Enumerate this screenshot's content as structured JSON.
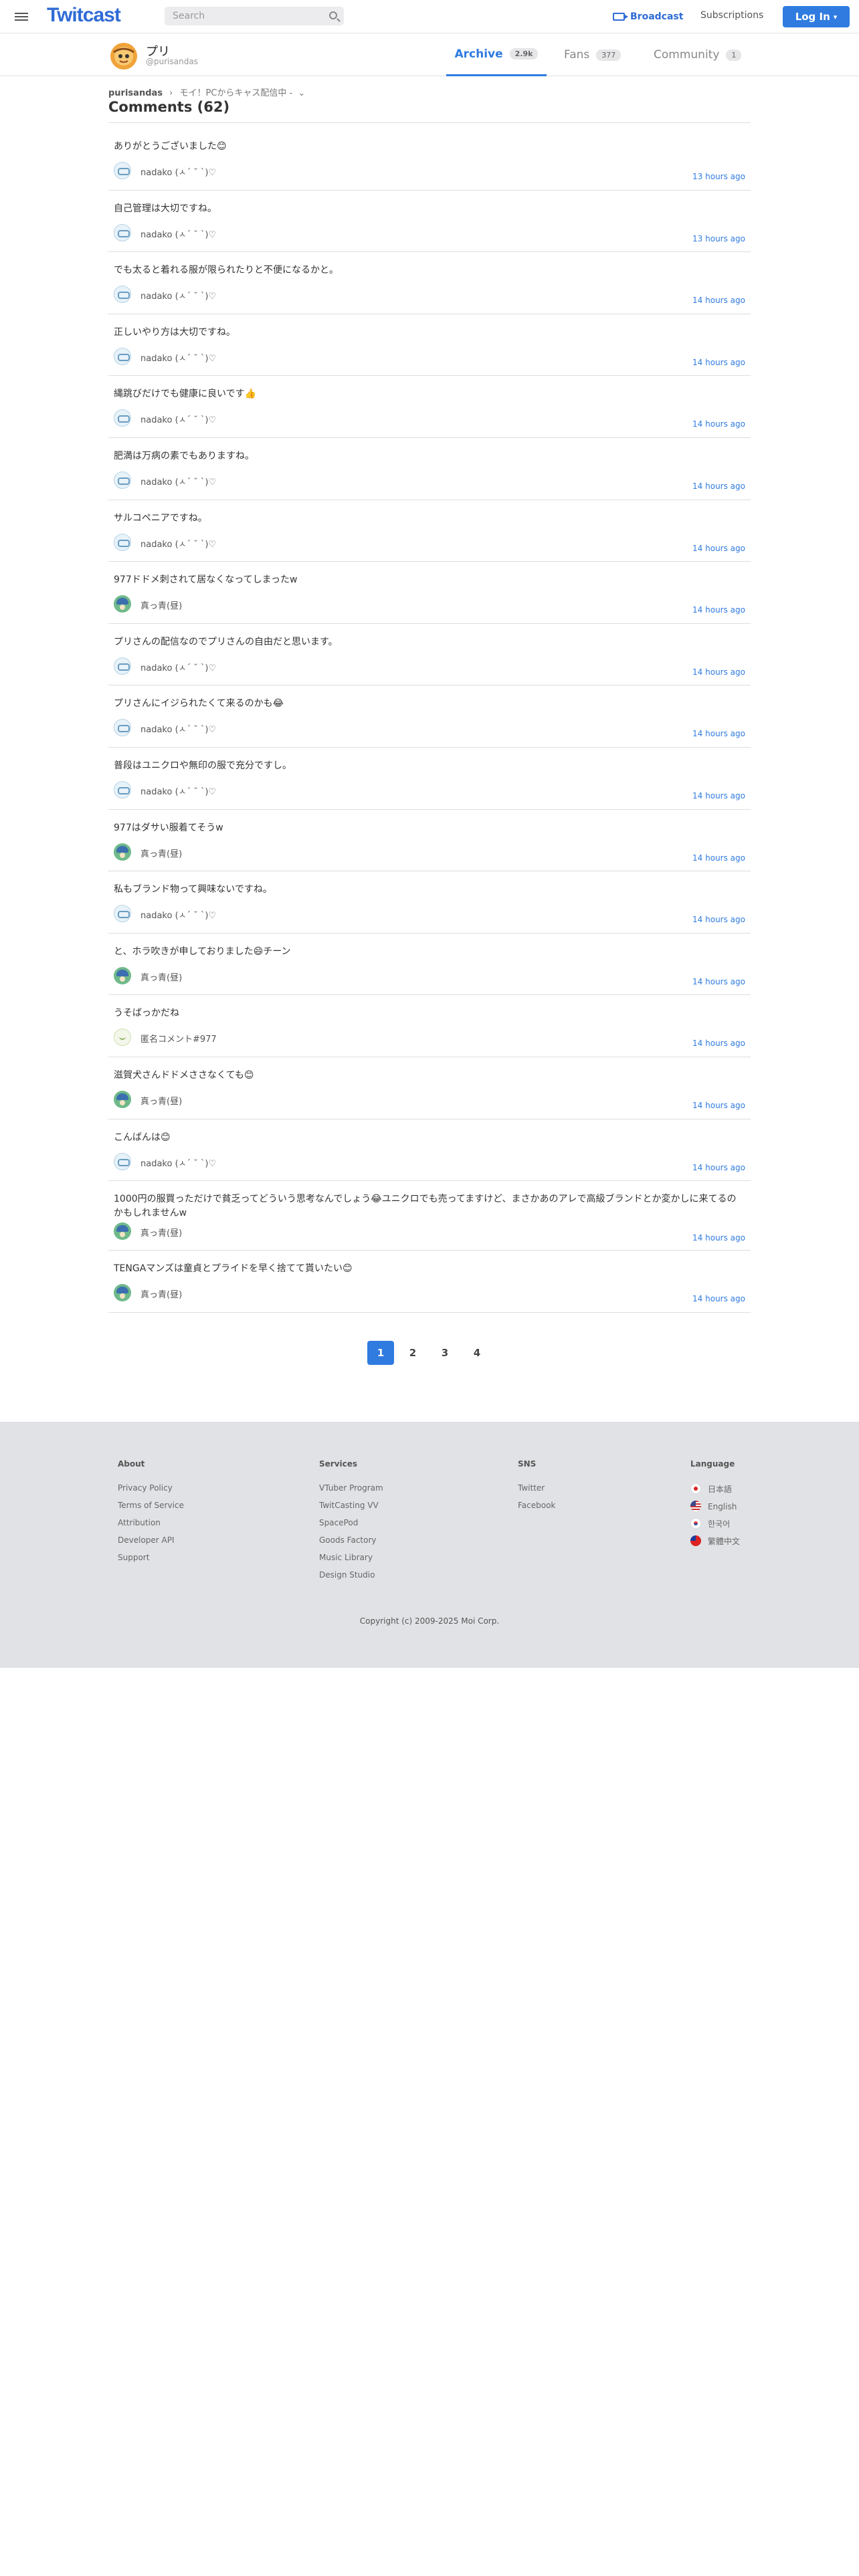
{
  "header": {
    "logo": "Twitcast",
    "search_placeholder": "Search",
    "broadcast": "Broadcast",
    "subscriptions": "Subscriptions",
    "login": "Log In"
  },
  "user": {
    "name": "プリ",
    "handle": "@purisandas"
  },
  "tabs": [
    {
      "label": "Archive",
      "count": "2.9k",
      "active": true
    },
    {
      "label": "Fans",
      "count": "377",
      "active": false
    },
    {
      "label": "Community",
      "count": "1",
      "active": false
    }
  ],
  "breadcrumb": {
    "user": "purisandas",
    "sep": "›",
    "movie": "モイ！PCからキャス配信中 -"
  },
  "page_title": "Comments (62)",
  "comments": [
    {
      "text": "ありがとうございました😊",
      "user": "nadako (ㅅ´ ˘ `)♡",
      "avatar": "nadako",
      "time": "13 hours ago"
    },
    {
      "text": "自己管理は大切ですね。",
      "user": "nadako (ㅅ´ ˘ `)♡",
      "avatar": "nadako",
      "time": "13 hours ago"
    },
    {
      "text": "でも太ると着れる服が限られたりと不便になるかと。",
      "user": "nadako (ㅅ´ ˘ `)♡",
      "avatar": "nadako",
      "time": "14 hours ago"
    },
    {
      "text": "正しいやり方は大切ですね。",
      "user": "nadako (ㅅ´ ˘ `)♡",
      "avatar": "nadako",
      "time": "14 hours ago"
    },
    {
      "text": "縄跳びだけでも健康に良いです👍",
      "user": "nadako (ㅅ´ ˘ `)♡",
      "avatar": "nadako",
      "time": "14 hours ago"
    },
    {
      "text": "肥満は万病の素でもありますね。",
      "user": "nadako (ㅅ´ ˘ `)♡",
      "avatar": "nadako",
      "time": "14 hours ago"
    },
    {
      "text": "サルコペニアですね。",
      "user": "nadako (ㅅ´ ˘ `)♡",
      "avatar": "nadako",
      "time": "14 hours ago"
    },
    {
      "text": "977ドドメ刺されて居なくなってしまったw",
      "user": "真っ青(昼)",
      "avatar": "mm",
      "time": "14 hours ago"
    },
    {
      "text": "プリさんの配信なのでプリさんの自由だと思います。",
      "user": "nadako (ㅅ´ ˘ `)♡",
      "avatar": "nadako",
      "time": "14 hours ago"
    },
    {
      "text": "プリさんにイジられたくて来るのかも😂",
      "user": "nadako (ㅅ´ ˘ `)♡",
      "avatar": "nadako",
      "time": "14 hours ago"
    },
    {
      "text": "普段はユニクロや無印の服で充分ですし。",
      "user": "nadako (ㅅ´ ˘ `)♡",
      "avatar": "nadako",
      "time": "14 hours ago"
    },
    {
      "text": "977はダサい服着てそうw",
      "user": "真っ青(昼)",
      "avatar": "mm",
      "time": "14 hours ago"
    },
    {
      "text": "私もブランド物って興味ないですね。",
      "user": "nadako (ㅅ´ ˘ `)♡",
      "avatar": "nadako",
      "time": "14 hours ago"
    },
    {
      "text": "と、ホラ吹きが申しておりました😄チーン",
      "user": "真っ青(昼)",
      "avatar": "mm",
      "time": "14 hours ago"
    },
    {
      "text": "うそばっかだね",
      "user": "匿名コメント#977",
      "avatar": "anon",
      "time": "14 hours ago"
    },
    {
      "text": "滋賀犬さんドドメささなくても😊",
      "user": "真っ青(昼)",
      "avatar": "mm",
      "time": "14 hours ago"
    },
    {
      "text": "こんばんは😊",
      "user": "nadako (ㅅ´ ˘ `)♡",
      "avatar": "nadako",
      "time": "14 hours ago"
    },
    {
      "text": "1000円の服買っただけで貧乏ってどういう思考なんでしょう😂ユニクロでも売ってますけど、まさかあのアレで高級ブランドとか変かしに来てるのかもしれませんw",
      "user": "真っ青(昼)",
      "avatar": "mm",
      "time": "14 hours ago"
    },
    {
      "text": "TENGAマンズは童貞とプライドを早く捨てて貰いたい😊",
      "user": "真っ青(昼)",
      "avatar": "mm",
      "time": "14 hours ago"
    }
  ],
  "pagination": [
    "1",
    "2",
    "3",
    "4"
  ],
  "footer": {
    "about": {
      "title": "About",
      "links": [
        "Privacy Policy",
        "Terms of Service",
        "Attribution",
        "Developer API",
        "Support"
      ]
    },
    "services": {
      "title": "Services",
      "links": [
        "VTuber Program",
        "TwitCasting VV",
        "SpacePod",
        "Goods Factory",
        "Music Library",
        "Design Studio"
      ]
    },
    "sns": {
      "title": "SNS",
      "links": [
        "Twitter",
        "Facebook"
      ]
    },
    "language": {
      "title": "Language",
      "links": [
        "日本語",
        "English",
        "한국어",
        "繁體中文"
      ]
    },
    "copyright": "Copyright (c) 2009-2025 Moi Corp."
  },
  "colors": {
    "accent": "#2f7be0",
    "footer_bg": "#e0e2e5"
  }
}
